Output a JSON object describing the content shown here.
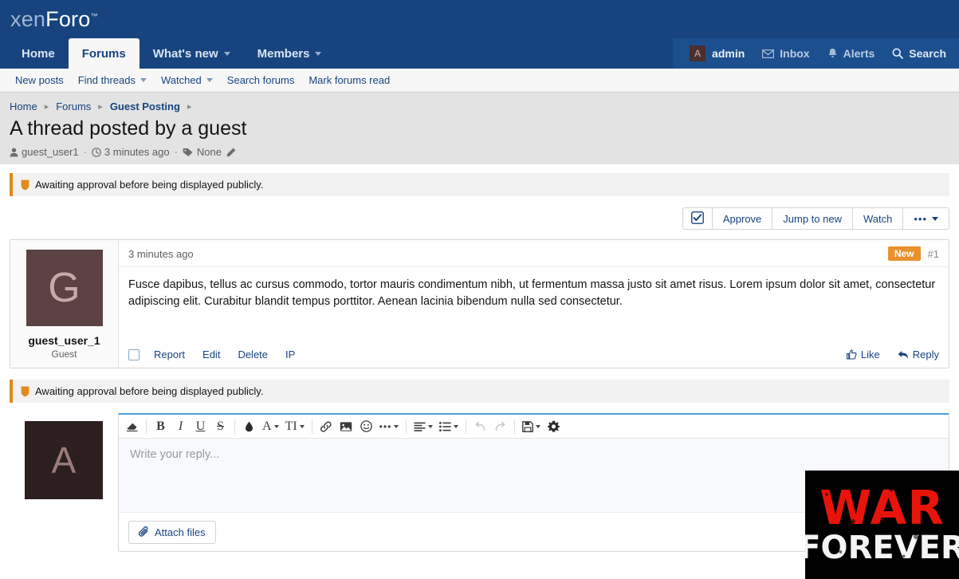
{
  "header": {
    "logo_first": "xen",
    "logo_second": "Foro",
    "logo_tm": "™"
  },
  "nav": {
    "tabs": [
      {
        "label": "Home",
        "active": false,
        "caret": false
      },
      {
        "label": "Forums",
        "active": true,
        "caret": false
      },
      {
        "label": "What's new",
        "active": false,
        "caret": true
      },
      {
        "label": "Members",
        "active": false,
        "caret": true
      }
    ],
    "account": {
      "avatar_letter": "A",
      "username": "admin",
      "inbox": "Inbox",
      "alerts": "Alerts",
      "search": "Search"
    }
  },
  "subnav": {
    "items": [
      {
        "label": "New posts",
        "caret": false
      },
      {
        "label": "Find threads",
        "caret": true
      },
      {
        "label": "Watched",
        "caret": true
      },
      {
        "label": "Search forums",
        "caret": false
      },
      {
        "label": "Mark forums read",
        "caret": false
      }
    ]
  },
  "pagehead": {
    "breadcrumb": [
      {
        "label": "Home",
        "bold": false
      },
      {
        "label": "Forums",
        "bold": false
      },
      {
        "label": "Guest Posting",
        "bold": true
      }
    ],
    "title": "A thread posted by a guest",
    "meta": {
      "author": "guest_user1",
      "time": "3 minutes ago",
      "tags_label": "None"
    }
  },
  "notice": {
    "text": "Awaiting approval before being displayed publicly."
  },
  "actionbar": {
    "buttons": [
      {
        "label": "",
        "icon": "check-square-icon",
        "icon_only": true
      },
      {
        "label": "Approve",
        "icon_only": false
      },
      {
        "label": "Jump to new",
        "icon_only": false
      },
      {
        "label": "Watch",
        "icon_only": false
      },
      {
        "label": "•••",
        "icon_only": false,
        "caret": true
      }
    ]
  },
  "post": {
    "author": {
      "avatar_letter": "G",
      "username": "guest_user_1",
      "user_title": "Guest"
    },
    "time": "3 minutes ago",
    "badge": "New",
    "number": "#1",
    "body": "Fusce dapibus, tellus ac cursus commodo, tortor mauris condimentum nibh, ut fermentum massa justo sit amet risus. Lorem ipsum dolor sit amet, consectetur adipiscing elit. Curabitur blandit tempus porttitor. Aenean lacinia bibendum nulla sed consectetur.",
    "footer_links": [
      "Report",
      "Edit",
      "Delete",
      "IP"
    ],
    "like_label": "Like",
    "reply_label": "Reply"
  },
  "notice2": {
    "text": "Awaiting approval before being displayed publicly."
  },
  "editor": {
    "avatar_letter": "A",
    "placeholder": "Write your reply...",
    "attach_label": "Attach files",
    "toolbar": [
      {
        "name": "remove-formatting-icon",
        "glyph": "◢",
        "type": "eraser"
      },
      {
        "sep": true
      },
      {
        "name": "bold-icon",
        "glyph": "B",
        "serif": true,
        "bold": true
      },
      {
        "name": "italic-icon",
        "glyph": "I",
        "serif": true,
        "italic": true
      },
      {
        "name": "underline-icon",
        "glyph": "U",
        "serif": true,
        "underline": true
      },
      {
        "name": "strikethrough-icon",
        "glyph": "S",
        "serif": true,
        "strike": true
      },
      {
        "sep": true
      },
      {
        "name": "text-color-icon",
        "glyph": "◆",
        "type": "drop"
      },
      {
        "name": "font-family-icon",
        "glyph": "A",
        "serif": true,
        "caret": true
      },
      {
        "name": "font-size-icon",
        "glyph": "TI",
        "serif": true,
        "caret": true
      },
      {
        "sep": true
      },
      {
        "name": "link-icon",
        "glyph": "⚭",
        "type": "link"
      },
      {
        "name": "insert-image-icon",
        "glyph": "❑",
        "type": "image"
      },
      {
        "name": "smilies-icon",
        "glyph": "☺",
        "type": "smiley"
      },
      {
        "name": "more-options-icon",
        "glyph": "•••",
        "caret": true
      },
      {
        "sep": true
      },
      {
        "name": "text-align-icon",
        "glyph": "≡",
        "caret": true
      },
      {
        "name": "list-icon",
        "glyph": "≣",
        "caret": true
      },
      {
        "sep": true
      },
      {
        "name": "undo-icon",
        "glyph": "↺",
        "disabled": true
      },
      {
        "name": "redo-icon",
        "glyph": "↻",
        "disabled": true
      },
      {
        "sep": true
      },
      {
        "name": "draft-icon",
        "glyph": "Ὃe",
        "caret": true,
        "type": "save"
      },
      {
        "name": "gear-icon",
        "glyph": "⚙",
        "type": "gear"
      }
    ]
  },
  "overlay": {
    "line1": "WAR",
    "line2": "FOREVER"
  },
  "colors": {
    "brand_blue": "#17447e",
    "link_blue": "#17447e",
    "accent_orange": "#e8912d",
    "notice_border": "#e08b1e",
    "editor_top": "#4f9ddb",
    "submit_blue": "#3ba3e8",
    "overlay_red": "#e8140c"
  }
}
